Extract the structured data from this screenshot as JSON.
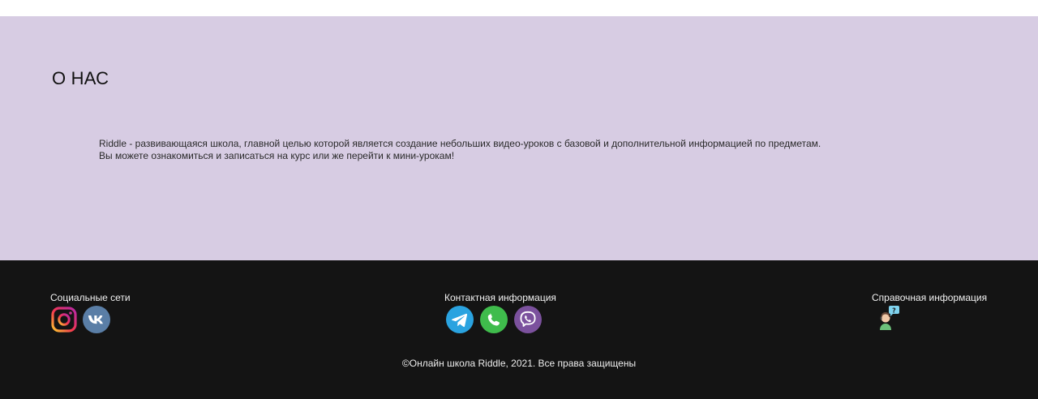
{
  "about": {
    "title": "О НАС",
    "line1": "Riddle - развивающаяся школа, главной целью которой является создание небольших видео-уроков с базовой и дополнительной информацией по предметам.",
    "line2": "Вы можете ознакомиться и записаться на курс или же перейти к мини-урокам!"
  },
  "footer": {
    "social": {
      "title": "Социальные сети",
      "icons": [
        "instagram-icon",
        "vk-icon"
      ]
    },
    "contact": {
      "title": "Контактная информация",
      "icons": [
        "telegram-icon",
        "whatsapp-icon",
        "viber-icon"
      ]
    },
    "help": {
      "title": "Справочная информация",
      "icons": [
        "support-agent-icon"
      ]
    },
    "copyright": "©Онлайн школа Riddle, 2021. Все права защищены"
  },
  "colors": {
    "about_bg": "#d7cce3",
    "footer_bg": "#141414",
    "telegram": "#2aa3e0",
    "whatsapp": "#3fbc4c",
    "viber": "#7b519d",
    "vk": "#5a7ea6"
  }
}
